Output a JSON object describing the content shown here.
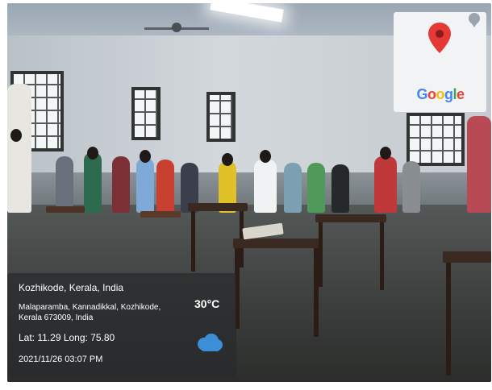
{
  "location": {
    "city": "Kozhikode, Kerala, India",
    "address": "Malaparamba, Kannadikkal, Kozhikode, Kerala 673009, India",
    "lat_long": "Lat: 11.29 Long: 75.80",
    "datetime": "2021/11/26 03:07 PM"
  },
  "weather": {
    "temperature": "30°C",
    "icon": "cloud-icon"
  },
  "map_badge": {
    "brand": "Google",
    "icon": "map-pin-icon"
  },
  "colors": {
    "pin_red": "#e53935",
    "google_blue": "#4285f4",
    "google_red": "#ea4335",
    "google_yellow": "#fbbc05",
    "google_green": "#34a853",
    "cloud_blue": "#3b8fd8"
  }
}
